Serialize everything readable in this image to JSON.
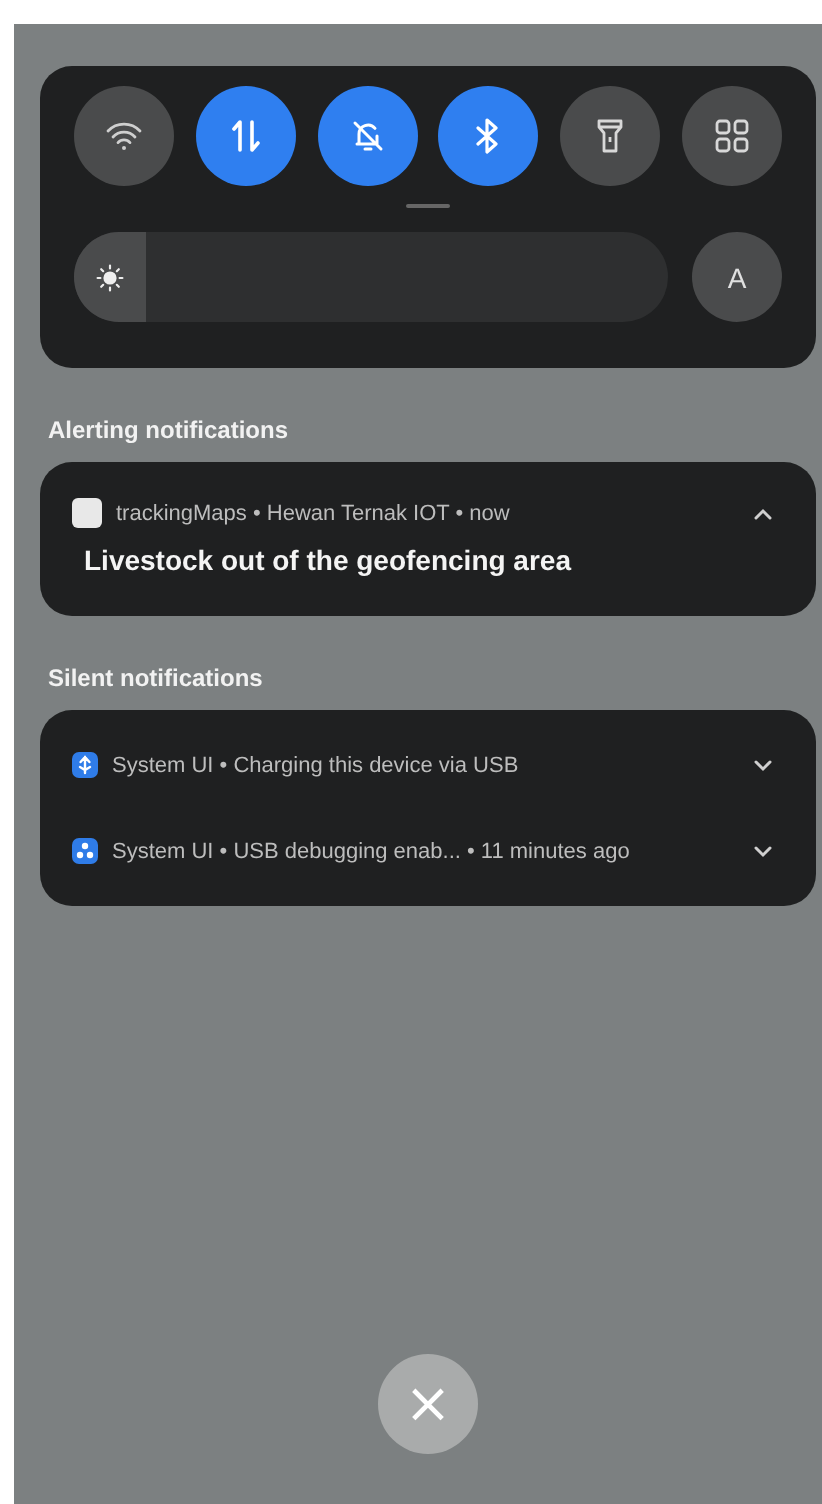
{
  "quick_settings": {
    "toggles": [
      {
        "kind": "wifi",
        "on": false
      },
      {
        "kind": "mobile-data",
        "on": true
      },
      {
        "kind": "silent",
        "on": true
      },
      {
        "kind": "bluetooth",
        "on": true
      },
      {
        "kind": "flashlight",
        "on": false
      },
      {
        "kind": "apps",
        "on": false
      }
    ],
    "brightness": {
      "level": 0.1
    },
    "auto_button": "A"
  },
  "sections": [
    {
      "title": "Alerting notifications",
      "notifications": [
        {
          "kind": "app",
          "header": "trackingMaps • Hewan Ternak IOT • now",
          "body": "Livestock out of the geofencing area",
          "expanded": true
        }
      ]
    },
    {
      "title": "Silent notifications",
      "notifications": [
        {
          "kind": "usb",
          "header": "System UI • Charging this device via USB",
          "expanded": false
        },
        {
          "kind": "debug",
          "header": "System UI • USB debugging enab... • 11 minutes ago",
          "expanded": false
        }
      ]
    }
  ],
  "close_button": "×"
}
